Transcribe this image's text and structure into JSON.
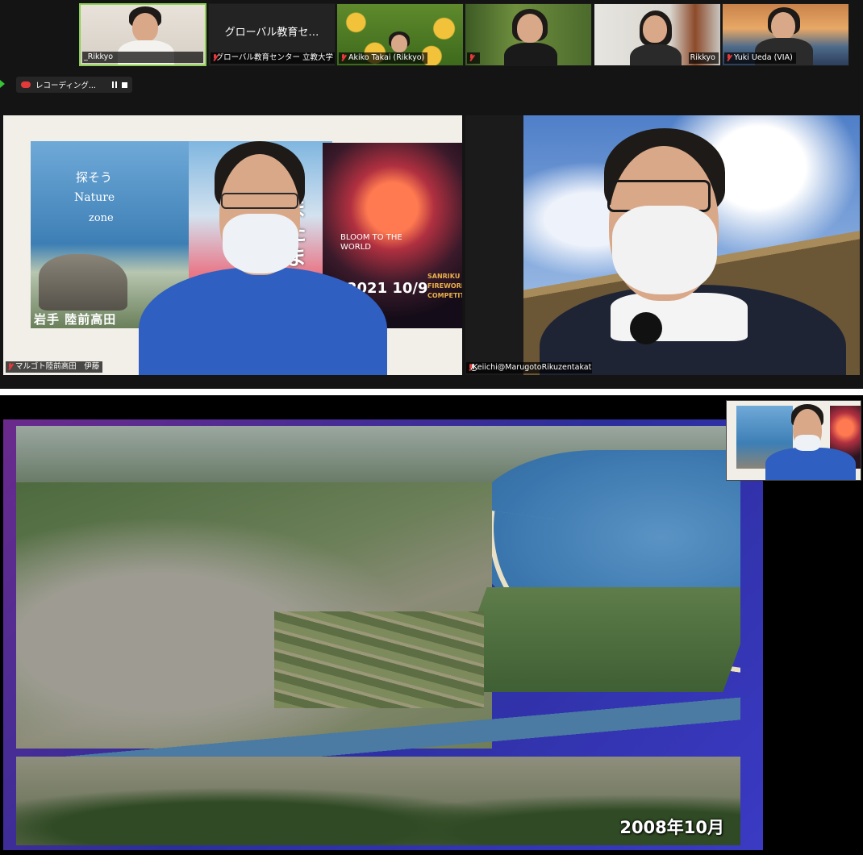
{
  "thumbnails": [
    {
      "name": "_Rikkyo",
      "muted": false,
      "active": true
    },
    {
      "name": "グローバル教育センター 立教大学",
      "tile_text": "グローバル教育セ…",
      "muted": true
    },
    {
      "name": "Akiko Takai (Rikkyo)",
      "muted": true
    },
    {
      "name": "",
      "muted": true
    },
    {
      "name": "Rikkyo",
      "muted": false
    },
    {
      "name": "Yuki Ueda (VIA)",
      "muted": true
    }
  ],
  "recording": {
    "label": "レコーディング..."
  },
  "videos": {
    "left": {
      "name": "マルゴト陸前高田　伊藤",
      "poster_text": {
        "line1": "探そう",
        "line2": "Nature",
        "line3": "zone",
        "big": "またまあるぞ。",
        "region": "岩手 陸前高田",
        "fireworks_title": "BLOOM TO THE WORLD",
        "fireworks_date": "2021 10/9",
        "fireworks_sub": "SANRIKU FIREWORKS COMPETITION"
      }
    },
    "right": {
      "name": "Keiichi@MarugotoRikuzentakata"
    }
  },
  "share": {
    "caption": "2008年10月"
  },
  "colors": {
    "active_border": "#8bd14f",
    "muted_icon": "#e23a3a",
    "share_frame": "#3a3ac4"
  }
}
